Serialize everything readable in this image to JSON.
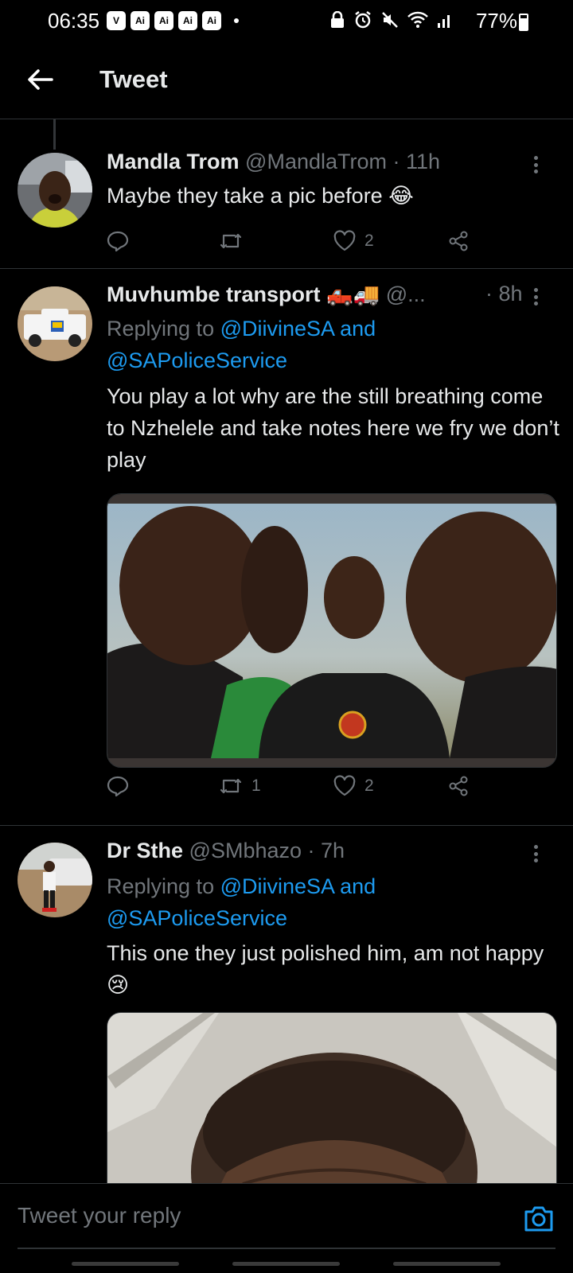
{
  "status_bar": {
    "time": "06:35",
    "badges": [
      "V",
      "Ai",
      "Ai",
      "Ai",
      "Ai"
    ],
    "battery": "77%"
  },
  "header": {
    "title": "Tweet"
  },
  "tweets": [
    {
      "name": "Mandla Trom",
      "handle": "@MandlaTrom",
      "time": "· 11h",
      "text": "Maybe they take a pic before 😂",
      "reply_count": "",
      "retweet_count": "",
      "like_count": "2"
    },
    {
      "name": "Muvhumbe transport 🛻🚚",
      "handle": "@...",
      "time": "· 8h",
      "replying_prefix": "Replying to",
      "replying_1": "@DiivineSA and",
      "replying_2": "@SAPoliceService",
      "text": "You play a lot why are the still breathing come to Nzhelele and take notes here we fry we don’t play",
      "reply_count": "",
      "retweet_count": "1",
      "like_count": "2"
    },
    {
      "name": "Dr Sthe",
      "handle": "@SMbhazo",
      "time": "· 7h",
      "replying_prefix": "Replying to",
      "replying_1": "@DiivineSA and",
      "replying_2": "@SAPoliceService",
      "text": "This one they just polished him, am not happy 😢"
    }
  ],
  "reply_bar": {
    "placeholder": "Tweet your reply"
  },
  "colors": {
    "accent": "#1d9bf0",
    "muted": "#71767b",
    "divider": "#2f3336"
  }
}
